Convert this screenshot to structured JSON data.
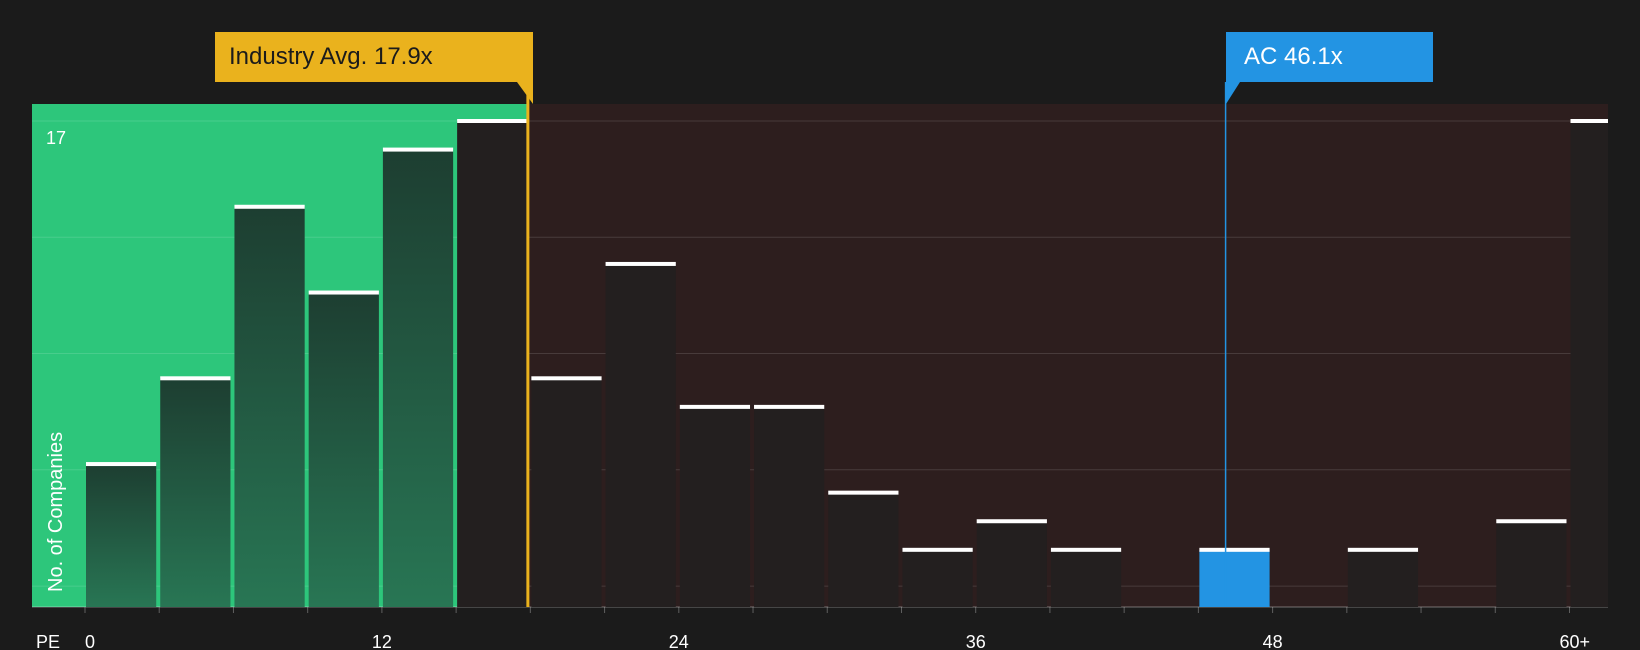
{
  "chart_data": {
    "type": "bar",
    "xlabel": "PE",
    "ylabel": "No. of Companies",
    "x_ticks": [
      "0",
      "12",
      "24",
      "36",
      "48",
      "60+"
    ],
    "y_ticks": [
      "17"
    ],
    "ylim": [
      0,
      17
    ],
    "bin_width": 3,
    "bins": [
      {
        "start": 0,
        "count": 5
      },
      {
        "start": 3,
        "count": 8
      },
      {
        "start": 6,
        "count": 14
      },
      {
        "start": 9,
        "count": 11
      },
      {
        "start": 12,
        "count": 16
      },
      {
        "start": 15,
        "count": 17
      },
      {
        "start": 18,
        "count": 8
      },
      {
        "start": 21,
        "count": 12
      },
      {
        "start": 24,
        "count": 7
      },
      {
        "start": 27,
        "count": 7
      },
      {
        "start": 30,
        "count": 4
      },
      {
        "start": 33,
        "count": 2
      },
      {
        "start": 36,
        "count": 3
      },
      {
        "start": 39,
        "count": 2
      },
      {
        "start": 42,
        "count": 0
      },
      {
        "start": 45,
        "count": 2,
        "highlight": true
      },
      {
        "start": 48,
        "count": 0
      },
      {
        "start": 51,
        "count": 2
      },
      {
        "start": 54,
        "count": 0
      },
      {
        "start": 57,
        "count": 3
      },
      {
        "start": 60,
        "count": 17
      }
    ],
    "industry_avg": {
      "label": "Industry Avg. 17.9x",
      "value": 17.9
    },
    "company": {
      "label": "AC 46.1x",
      "value": 46.1
    },
    "grid": true
  },
  "colors": {
    "background": "#1b1b1b",
    "below_avg_zone": "#2dc67b",
    "above_avg_zone": "#2d1e1e",
    "industry": "#eab21d",
    "company": "#2394e3"
  }
}
